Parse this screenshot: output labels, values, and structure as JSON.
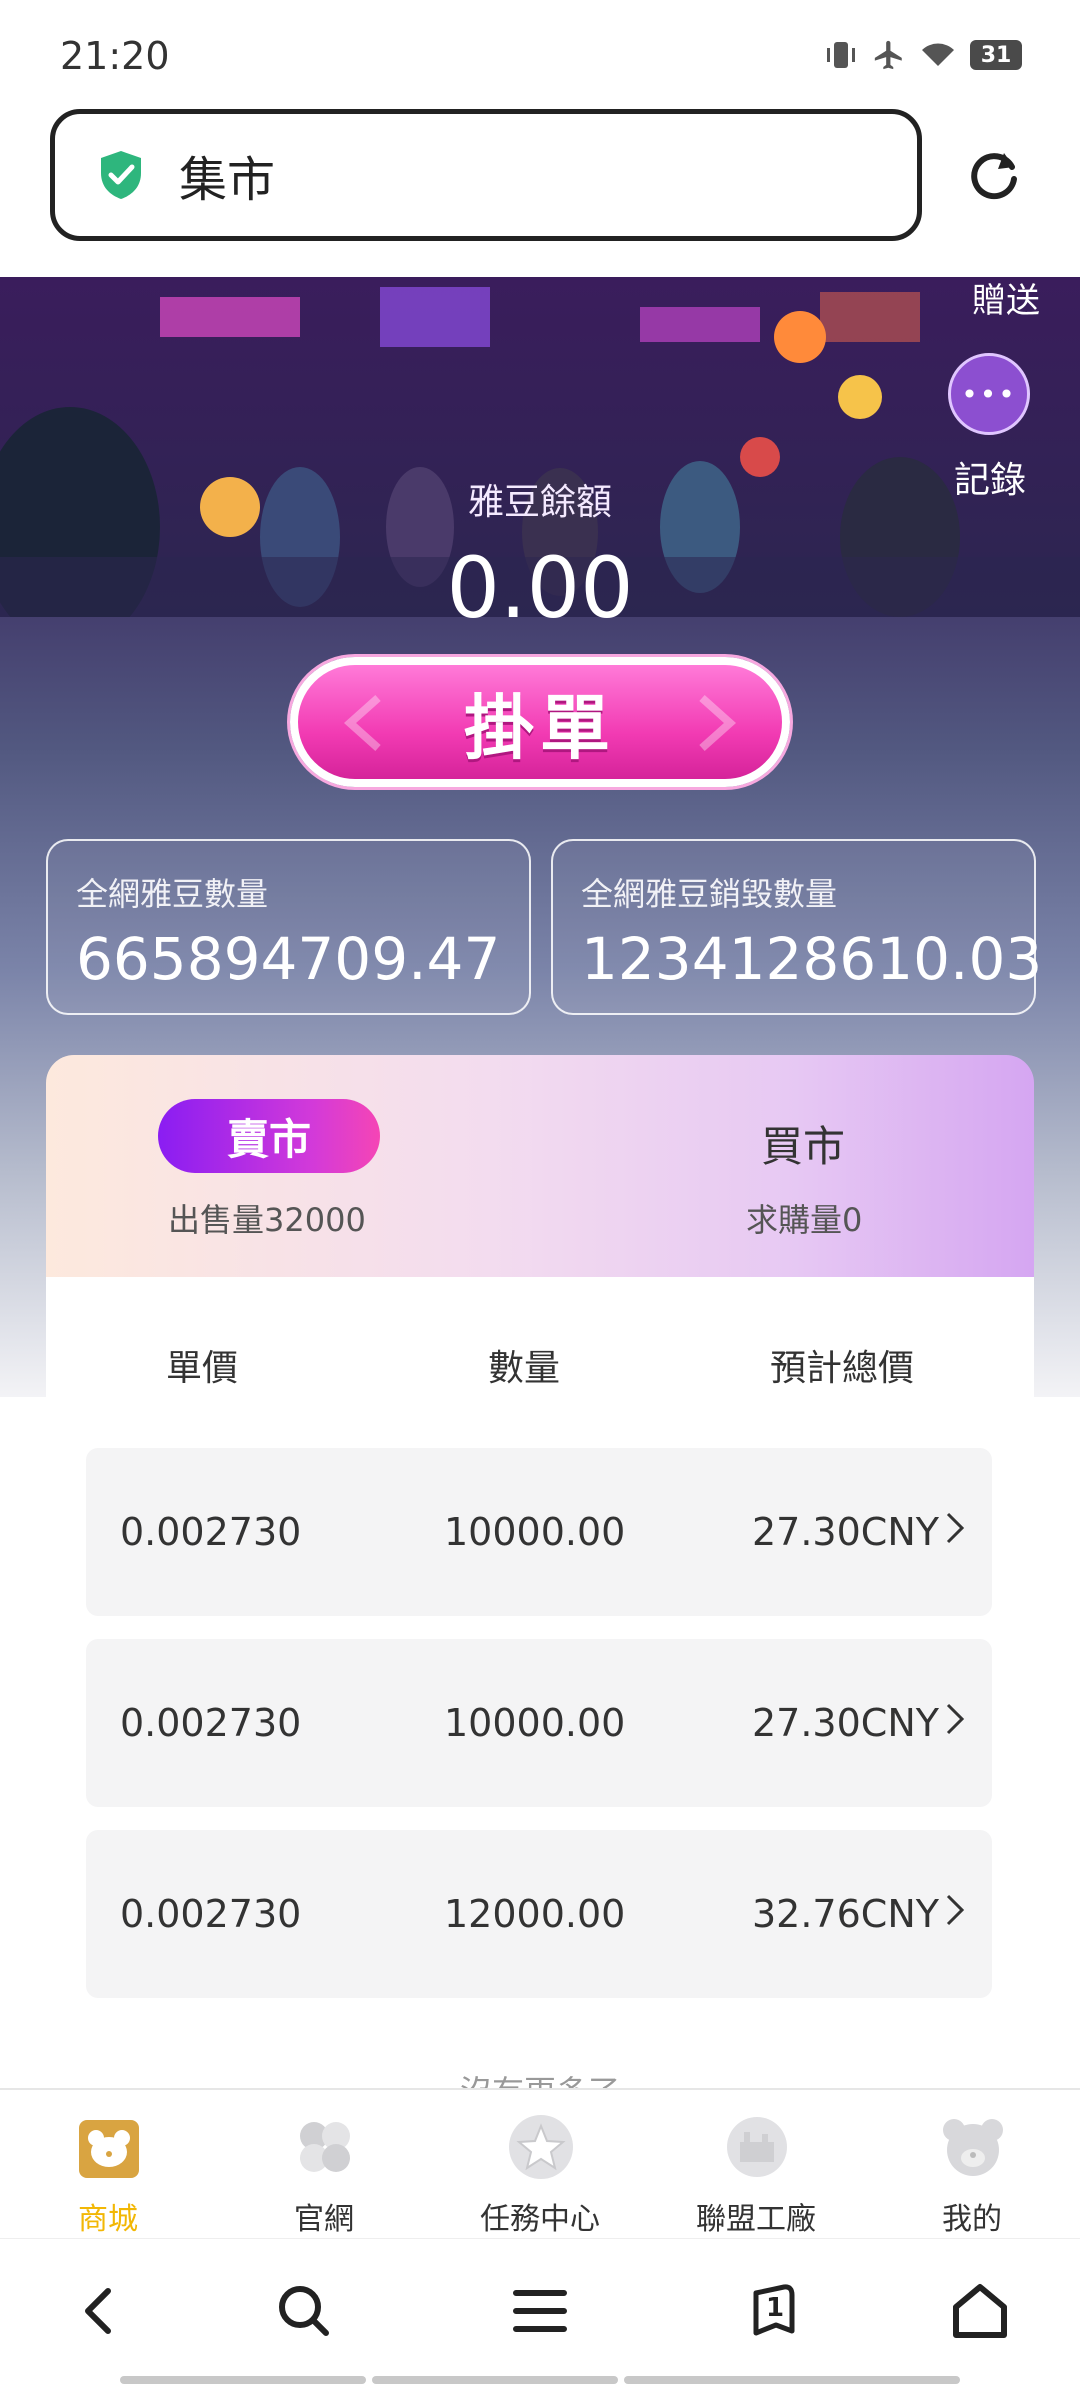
{
  "status": {
    "time": "21:20",
    "battery": "31"
  },
  "browser": {
    "address_title": "集市"
  },
  "hero": {
    "gift_label": "贈送",
    "record_label": "記錄",
    "record_icon": "•••",
    "balance_label": "雅豆餘額",
    "balance_value": "0.00",
    "post_button_label": "掛單"
  },
  "stats": [
    {
      "label": "全網雅豆數量",
      "value": "665894709.47"
    },
    {
      "label": "全網雅豆銷毀數量",
      "value": "1234128610.03"
    }
  ],
  "market": {
    "sell_tab": "賣市",
    "sell_sub": "出售量32000",
    "buy_tab": "買市",
    "buy_sub": "求購量0",
    "columns": [
      "單價",
      "數量",
      "預計總價"
    ],
    "rows": [
      {
        "price": "0.002730",
        "quantity": "10000.00",
        "total": "27.30CNY"
      },
      {
        "price": "0.002730",
        "quantity": "10000.00",
        "total": "27.30CNY"
      },
      {
        "price": "0.002730",
        "quantity": "12000.00",
        "total": "32.76CNY"
      }
    ],
    "no_more": "沒有更多了"
  },
  "tabbar": [
    {
      "label": "商城",
      "icon": "bear-shop-icon",
      "active": true
    },
    {
      "label": "官網",
      "icon": "clover-icon",
      "active": false
    },
    {
      "label": "任務中心",
      "icon": "star-icon",
      "active": false
    },
    {
      "label": "聯盟工廠",
      "icon": "factory-icon",
      "active": false
    },
    {
      "label": "我的",
      "icon": "bear-profile-icon",
      "active": false
    }
  ],
  "browser_nav": {
    "tab_count": "1"
  },
  "colors": {
    "active_tab": "#f2b705",
    "accent_pink": "#f23bb3",
    "accent_purple": "#8a1df2"
  }
}
